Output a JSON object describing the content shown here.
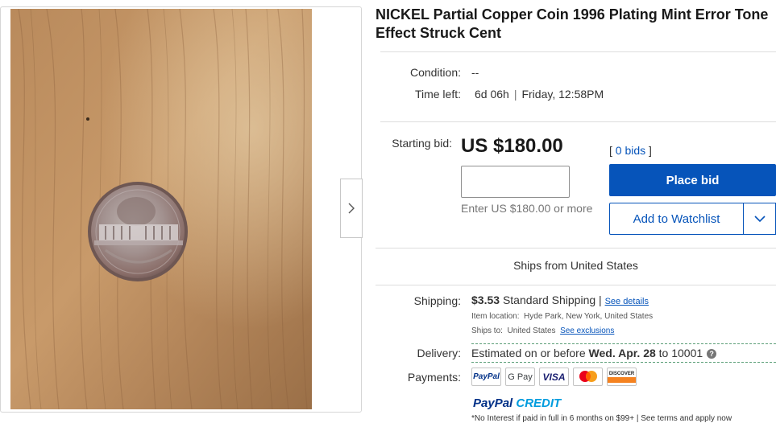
{
  "listing": {
    "title": "NICKEL Partial Copper Coin 1996 Plating Mint Error Tone Effect Struck Cent"
  },
  "gallery": {
    "image_icon": "coin-photo",
    "next_icon": "chevron-right-icon"
  },
  "details": {
    "condition_label": "Condition:",
    "condition_value": "--",
    "time_left_label": "Time left:",
    "time_left_value": "6d 06h",
    "time_left_end": "Friday, 12:58PM"
  },
  "bidding": {
    "starting_bid_label": "Starting bid:",
    "price": "US $180.00",
    "bids_open": "[",
    "bids_link": "0 bids",
    "bids_close": "]",
    "input_value": "",
    "enter_hint": "Enter US $180.00 or more",
    "place_bid_label": "Place bid",
    "watchlist_label": "Add to Watchlist",
    "watchlist_caret_icon": "chevron-down-icon"
  },
  "shipping": {
    "ships_from": "Ships from United States",
    "label": "Shipping:",
    "cost": "$3.53",
    "method": "Standard Shipping",
    "divider": "|",
    "details_link": "See details",
    "item_location_label": "Item location:",
    "item_location": "Hyde Park, New York, United States",
    "ships_to_label": "Ships to:",
    "ships_to": "United States",
    "exclusions_link": "See exclusions"
  },
  "delivery": {
    "label": "Delivery:",
    "prefix": "Estimated on or before",
    "date": "Wed. Apr. 28",
    "suffix": "to 10001",
    "help_icon": "question-circle-icon",
    "help_glyph": "?"
  },
  "payments": {
    "label": "Payments:",
    "methods": [
      "PayPal",
      "G Pay",
      "VISA",
      "Mastercard",
      "DISCOVER"
    ],
    "paypal_credit_a": "PayPal",
    "paypal_credit_b": "CREDIT",
    "fine_print": "*No Interest if paid in full in 6 months on $99+ | See terms and apply now"
  },
  "colors": {
    "accent": "#0654ba",
    "paypal_dark": "#003087",
    "paypal_light": "#009cde",
    "delivery_dash": "#5a9e77"
  }
}
